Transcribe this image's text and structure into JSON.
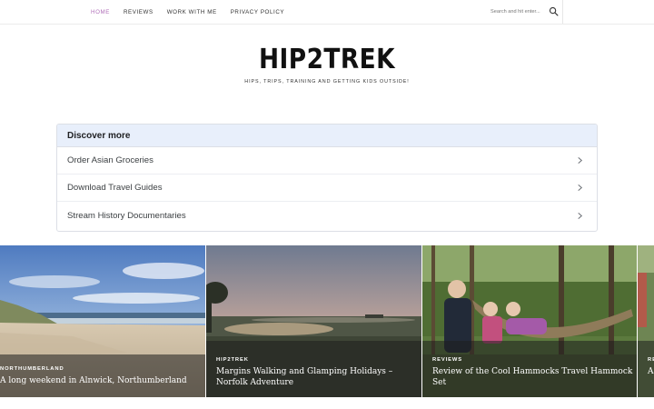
{
  "nav": {
    "items": [
      {
        "label": "HOME",
        "active": true
      },
      {
        "label": "REVIEWS",
        "active": false
      },
      {
        "label": "WORK WITH ME",
        "active": false
      },
      {
        "label": "PRIVACY POLICY",
        "active": false
      }
    ],
    "search_placeholder": "Search and hit enter...",
    "search_icon": "search-icon",
    "active_color": "#b06fb9"
  },
  "header": {
    "title": "HIP2TREK",
    "tagline": "HIPS, TRIPS, TRAINING AND GETTING KIDS OUTSIDE!"
  },
  "discover": {
    "heading": "Discover more",
    "items": [
      {
        "label": "Order Asian Groceries",
        "icon": "chevron-right-icon"
      },
      {
        "label": "Download Travel Guides",
        "icon": "chevron-right-icon"
      },
      {
        "label": "Stream History Documentaries",
        "icon": "chevron-right-icon"
      }
    ],
    "header_color": "#e8effb"
  },
  "cards": [
    {
      "category": "NORTHUMBERLAND",
      "title": "A long weekend in Alnwick, Northumberland"
    },
    {
      "category": "HIP2TREK",
      "title": "Margins Walking and Glamping Holidays – Norfolk Adventure"
    },
    {
      "category": "REVIEWS",
      "title": "Review of the Cool Hammocks Travel Hammock Set"
    },
    {
      "category": "RE",
      "title": "A"
    }
  ]
}
